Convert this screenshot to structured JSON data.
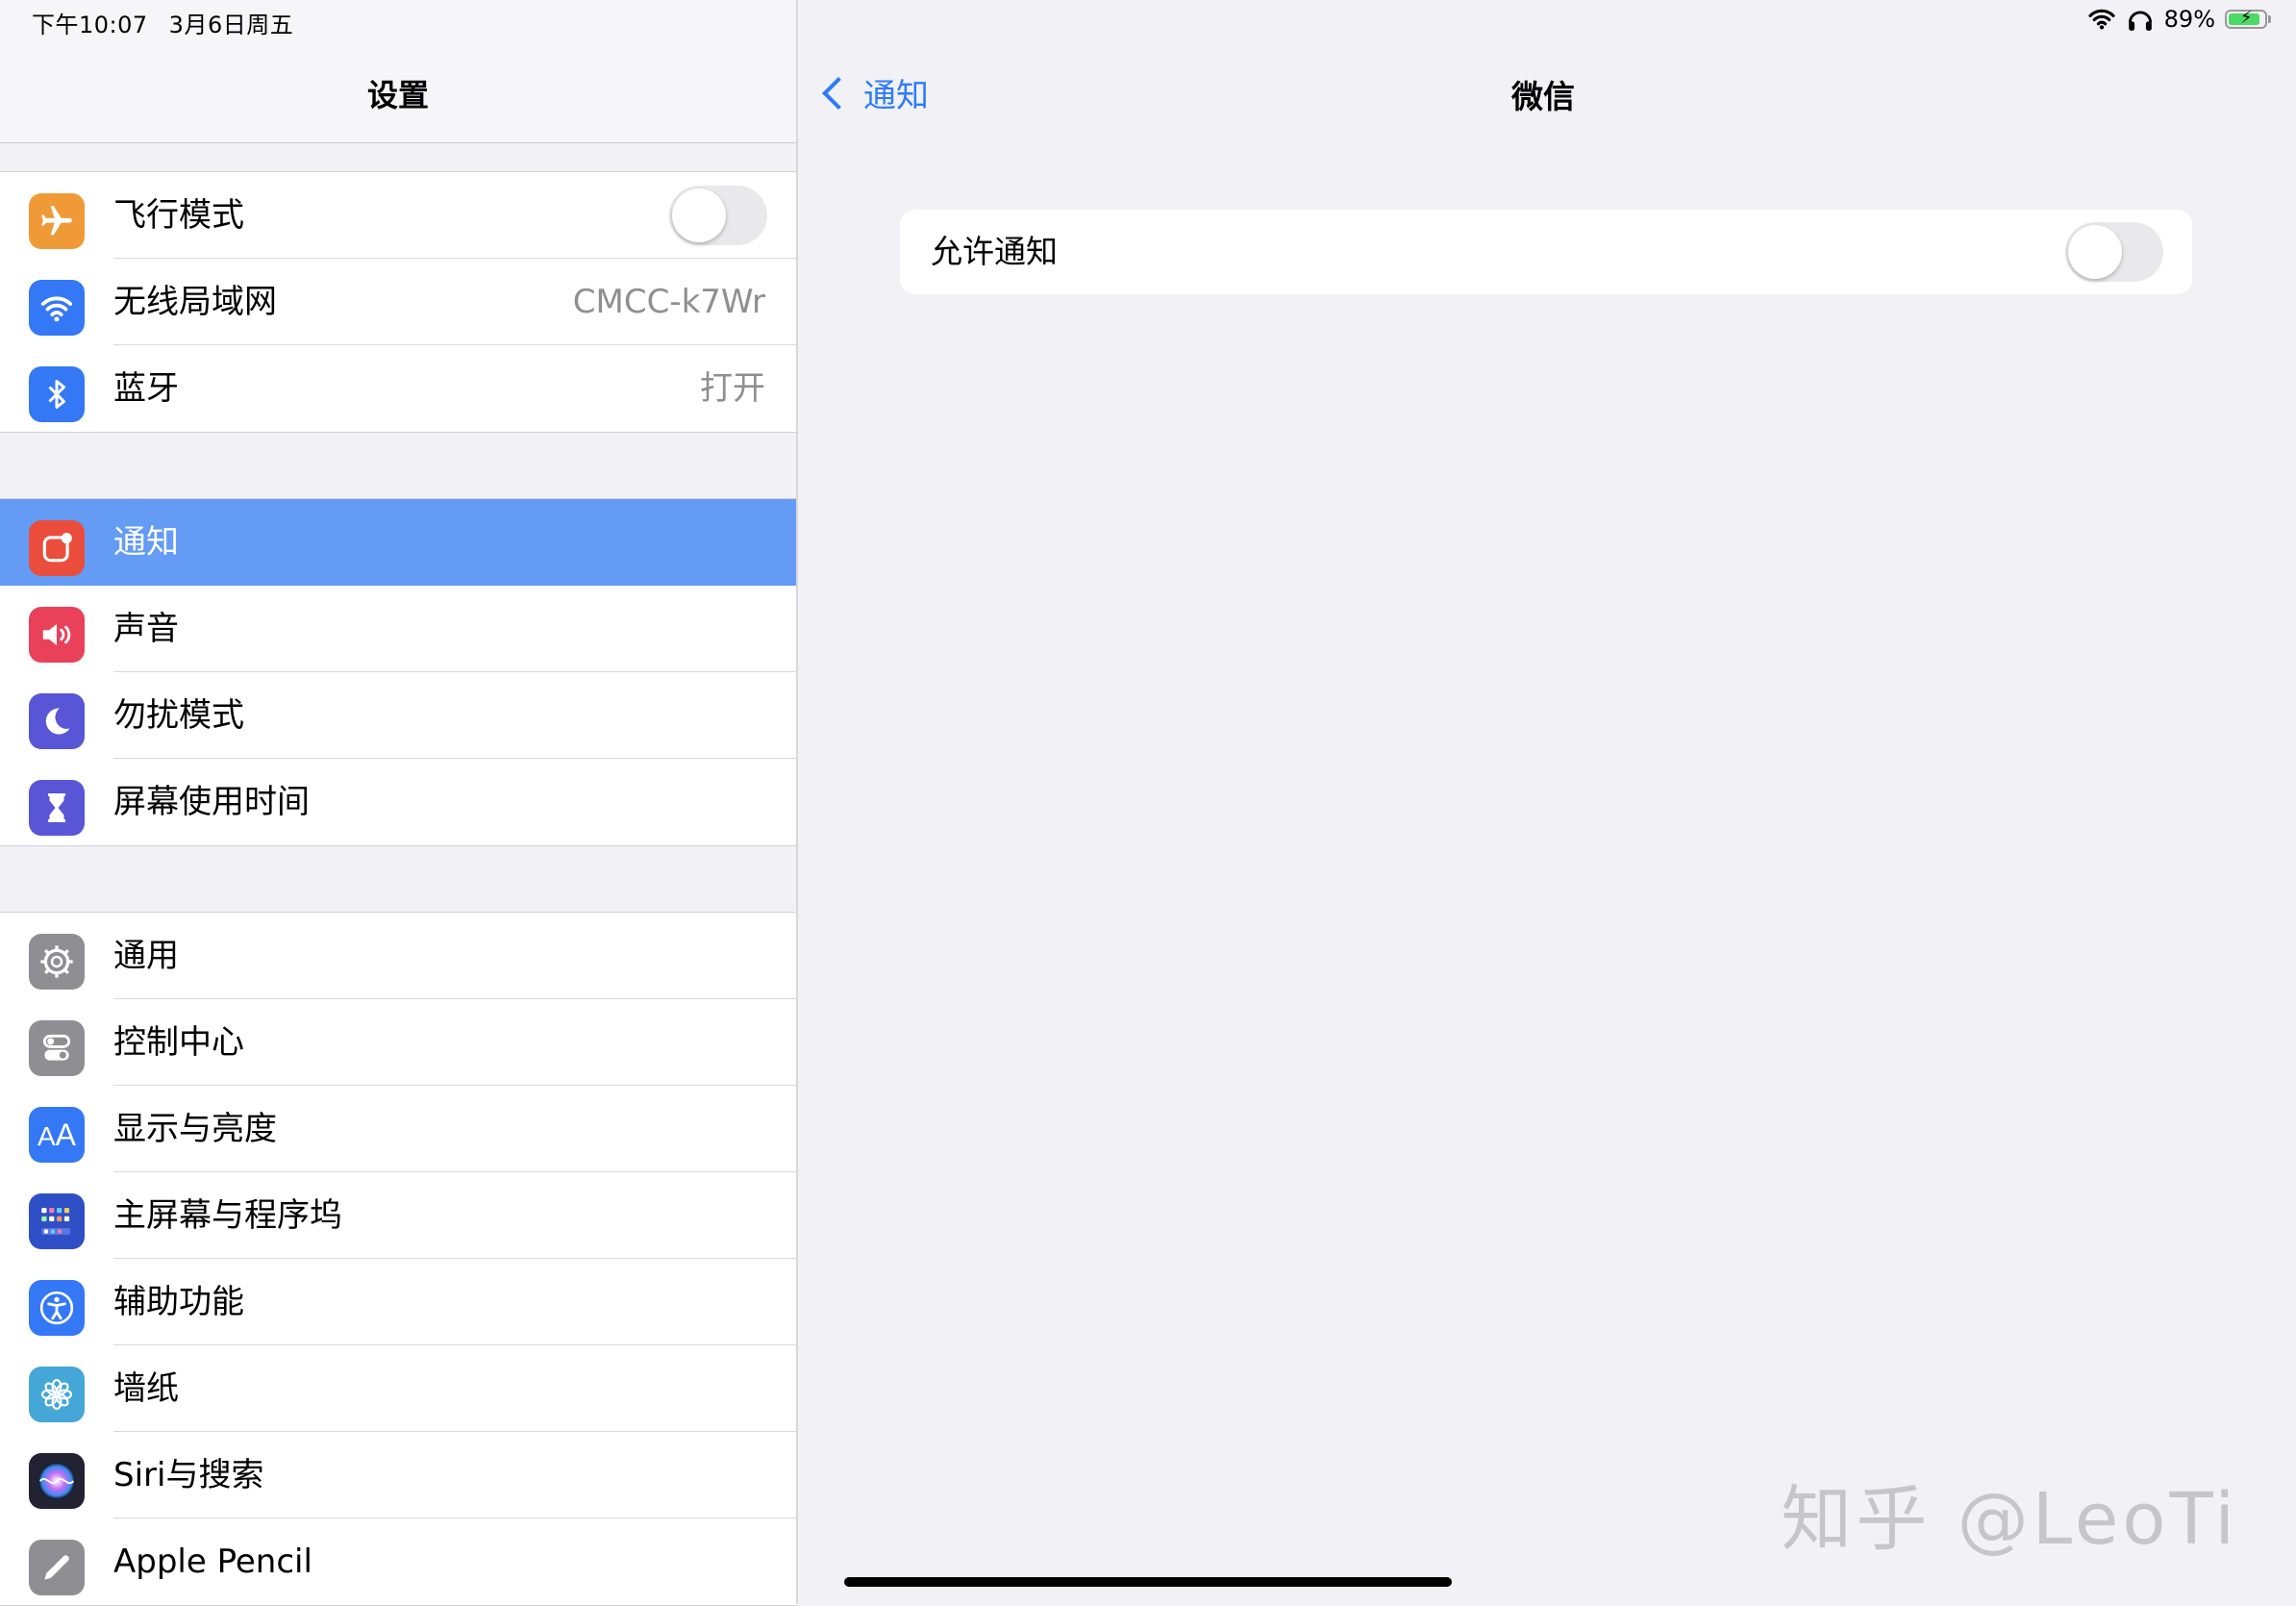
{
  "status_bar": {
    "time": "下午10:07",
    "date": "3月6日周五",
    "battery": "89%"
  },
  "sidebar": {
    "title": "设置",
    "groups": [
      {
        "items": [
          {
            "label": "飞行模式",
            "icon": "airplane-icon",
            "color": "#f09a37",
            "toggle": false
          },
          {
            "label": "无线局域网",
            "icon": "wifi-icon",
            "color": "#3478f6",
            "value": "CMCC-k7Wr"
          },
          {
            "label": "蓝牙",
            "icon": "bluetooth-icon",
            "color": "#3478f6",
            "value": "打开"
          }
        ]
      },
      {
        "items": [
          {
            "label": "通知",
            "icon": "notifications-icon",
            "color": "#eb4d3d",
            "selected": true
          },
          {
            "label": "声音",
            "icon": "speaker-icon",
            "color": "#e9415a"
          },
          {
            "label": "勿扰模式",
            "icon": "moon-icon",
            "color": "#5856d6"
          },
          {
            "label": "屏幕使用时间",
            "icon": "hourglass-icon",
            "color": "#5856d6"
          }
        ]
      },
      {
        "items": [
          {
            "label": "通用",
            "icon": "gear-icon",
            "color": "#8e8e93"
          },
          {
            "label": "控制中心",
            "icon": "switches-icon",
            "color": "#8e8e93"
          },
          {
            "label": "显示与亮度",
            "icon": "text-size-icon",
            "color": "#3478f6"
          },
          {
            "label": "主屏幕与程序坞",
            "icon": "home-grid-icon",
            "color": "#2f4fc7"
          },
          {
            "label": "辅助功能",
            "icon": "accessibility-icon",
            "color": "#3478f6"
          },
          {
            "label": "墙纸",
            "icon": "flower-icon",
            "color": "#45a6d8"
          },
          {
            "label": "Siri与搜索",
            "icon": "siri-icon",
            "color": "#222233"
          },
          {
            "label": "Apple Pencil",
            "icon": "pencil-icon",
            "color": "#8e8e93"
          }
        ]
      }
    ]
  },
  "detail": {
    "back_label": "通知",
    "title": "微信",
    "allow_notifications_label": "允许通知",
    "allow_notifications": false
  },
  "watermark": "知乎 @LeoTi"
}
